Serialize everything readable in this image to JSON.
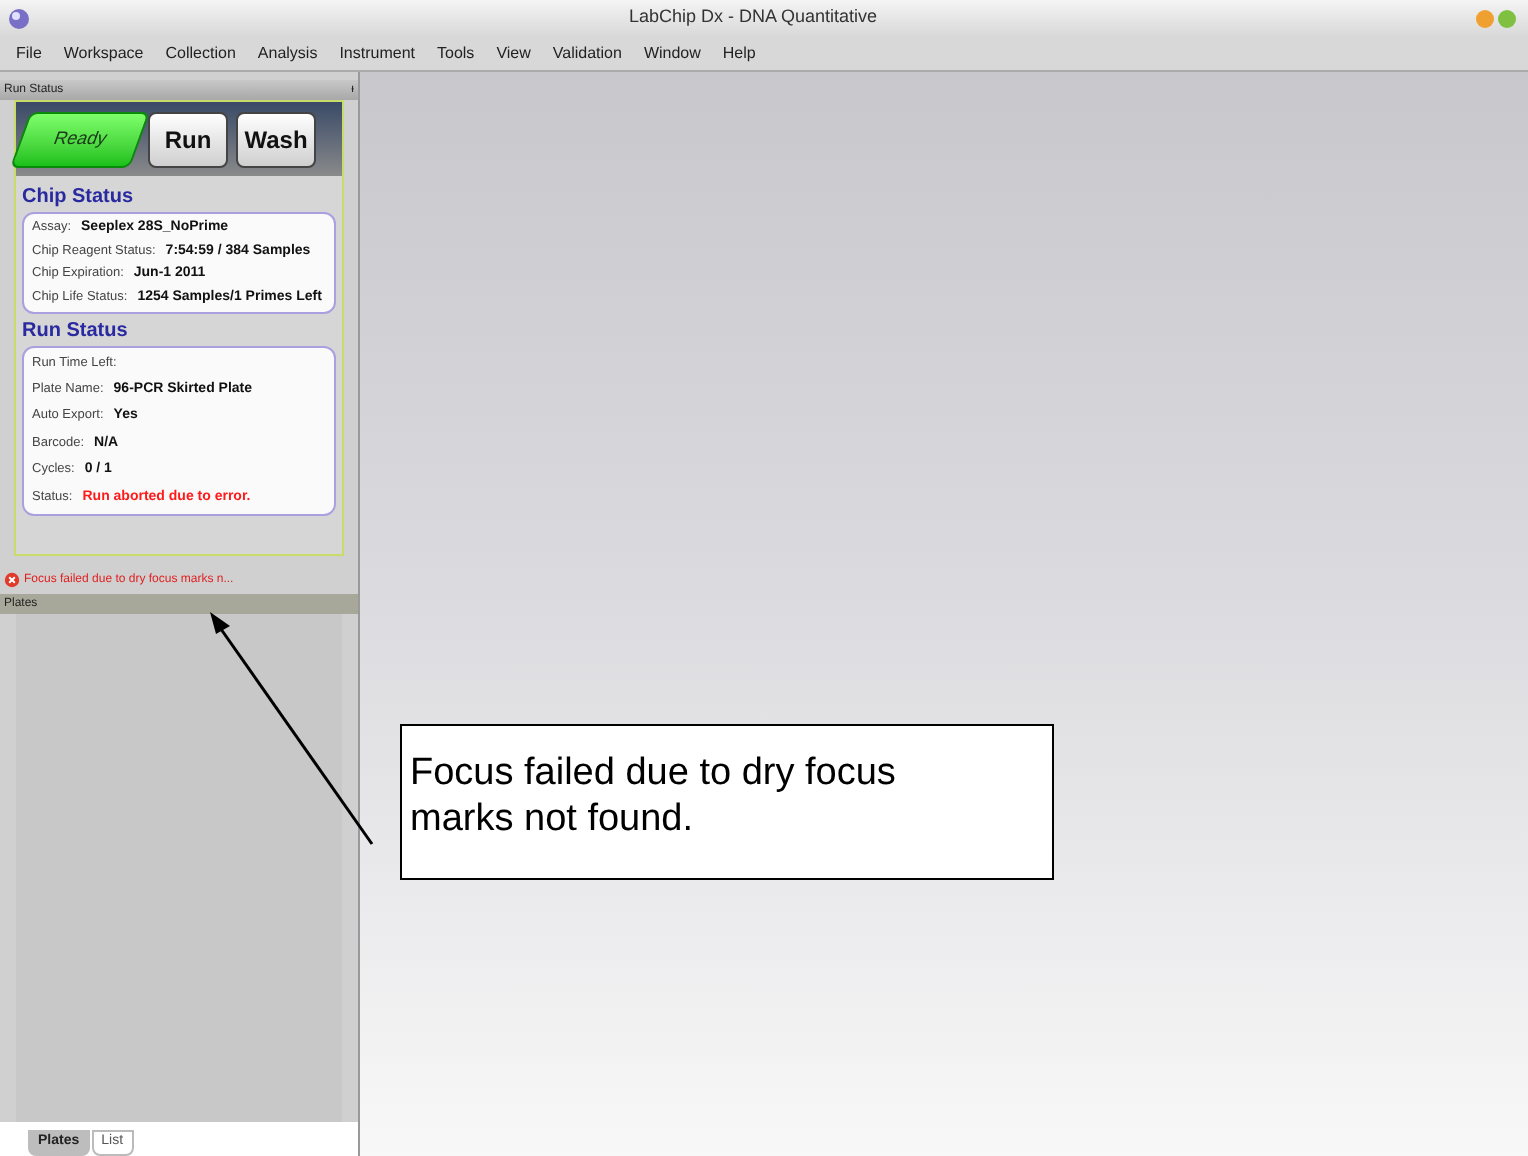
{
  "window": {
    "title": "LabChip Dx - DNA Quantitative"
  },
  "menu": [
    "File",
    "Workspace",
    "Collection",
    "Analysis",
    "Instrument",
    "Tools",
    "View",
    "Validation",
    "Window",
    "Help"
  ],
  "run_panel": {
    "title": "Run Status",
    "pin": "ᵻ",
    "mode_buttons": [
      {
        "label": "Ready",
        "selected": true
      },
      {
        "label": "Run",
        "selected": false
      },
      {
        "label": "Wash",
        "selected": false
      }
    ],
    "chip_status": {
      "heading": "Chip Status",
      "fields": [
        {
          "label": "Assay:",
          "value": "Seeplex 28S_NoPrime"
        },
        {
          "label": "Chip Reagent Status:",
          "value": "7:54:59 / 384 Samples"
        },
        {
          "label": "Chip Expiration:",
          "value": "Jun-1 2011"
        },
        {
          "label": "Chip Life Status:",
          "value": "1254 Samples/1 Primes Left"
        }
      ]
    },
    "run_status": {
      "heading": "Run Status",
      "fields": [
        {
          "label": "Run Time Left:",
          "kind": "plain"
        },
        {
          "label": "Plate Name:",
          "value": "96-PCR Skirted Plate",
          "kind": "plain"
        },
        {
          "label": "Auto Export:",
          "value": "Yes",
          "kind": "plain"
        },
        {
          "label": "Barcode:",
          "value": "N/A",
          "kind": "plain"
        },
        {
          "label": "Cycles:",
          "value": "0 / 1",
          "kind": "plain"
        },
        {
          "label": "Status:",
          "value": "Run aborted due to error.",
          "kind": "error"
        }
      ]
    },
    "error_message": "Focus failed due to dry focus marks n..."
  },
  "plates_panel": {
    "title": "Plates",
    "tabs": [
      {
        "label": "Plates",
        "selected": true
      },
      {
        "label": "List",
        "selected": false
      }
    ]
  },
  "callout": "Focus failed due to dry focus marks not found."
}
